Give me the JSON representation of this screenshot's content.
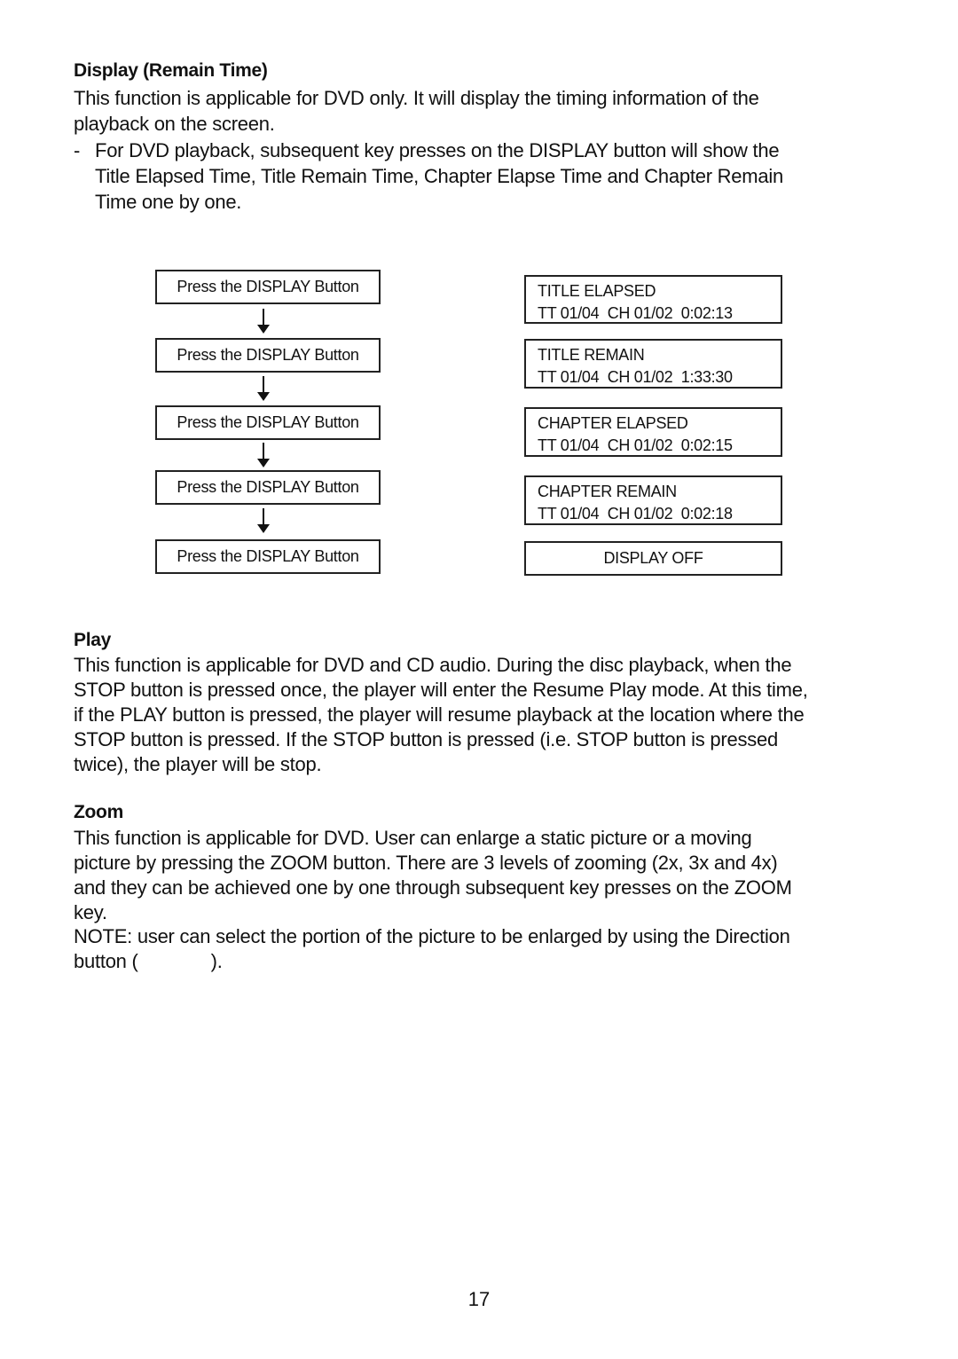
{
  "sections": {
    "display": {
      "heading": "Display (Remain Time)",
      "intro_line1": "This function is applicable for DVD only.  It will display the timing information of the",
      "intro_line2": "playback on the screen.",
      "bullet_dash": "-",
      "bullet_line1": "For DVD playback, subsequent key presses on the DISPLAY button will show the",
      "bullet_line2": "Title Elapsed Time, Title Remain Time, Chapter Elapse Time and Chapter Remain",
      "bullet_line3": "Time one by one."
    },
    "play": {
      "heading": "Play",
      "lines": [
        "This function is applicable for DVD and CD audio.  During the disc playback, when the",
        "STOP button is pressed once, the player will enter the Resume Play mode.  At this time,",
        "if the PLAY button is pressed, the player will resume playback at the location where the",
        "STOP button is pressed.  If the STOP button is pressed (i.e. STOP button is pressed",
        "twice), the player will be stop."
      ]
    },
    "zoom": {
      "heading": "Zoom",
      "lines": [
        "This function is applicable for DVD.  User can enlarge a static picture or a moving",
        "picture by pressing the ZOOM button.  There are 3 levels of zooming (2x, 3x and 4x)",
        "and they can be achieved one by one through subsequent key presses on the ZOOM",
        "key.",
        "NOTE: user can select the portion of the picture to be enlarged by using the Direction",
        "button (              )."
      ]
    }
  },
  "diagram": {
    "steps": [
      {
        "action": "Press the DISPLAY Button",
        "result_title": "TITLE ELAPSED",
        "result_info": "TT 01/04  CH 01/02  0:02:13"
      },
      {
        "action": "Press the DISPLAY Button",
        "result_title": "TITLE REMAIN",
        "result_info": "TT 01/04  CH 01/02  1:33:30"
      },
      {
        "action": "Press the DISPLAY Button",
        "result_title": "CHAPTER ELAPSED",
        "result_info": "TT 01/04  CH 01/02  0:02:15"
      },
      {
        "action": "Press the DISPLAY Button",
        "result_title": "CHAPTER REMAIN",
        "result_info": "TT 01/04  CH 01/02  0:02:18"
      },
      {
        "action": "Press the DISPLAY Button",
        "result_title": "DISPLAY OFF",
        "result_info": ""
      }
    ],
    "arrow_icon": "down-arrow-icon"
  },
  "page_number": "17"
}
